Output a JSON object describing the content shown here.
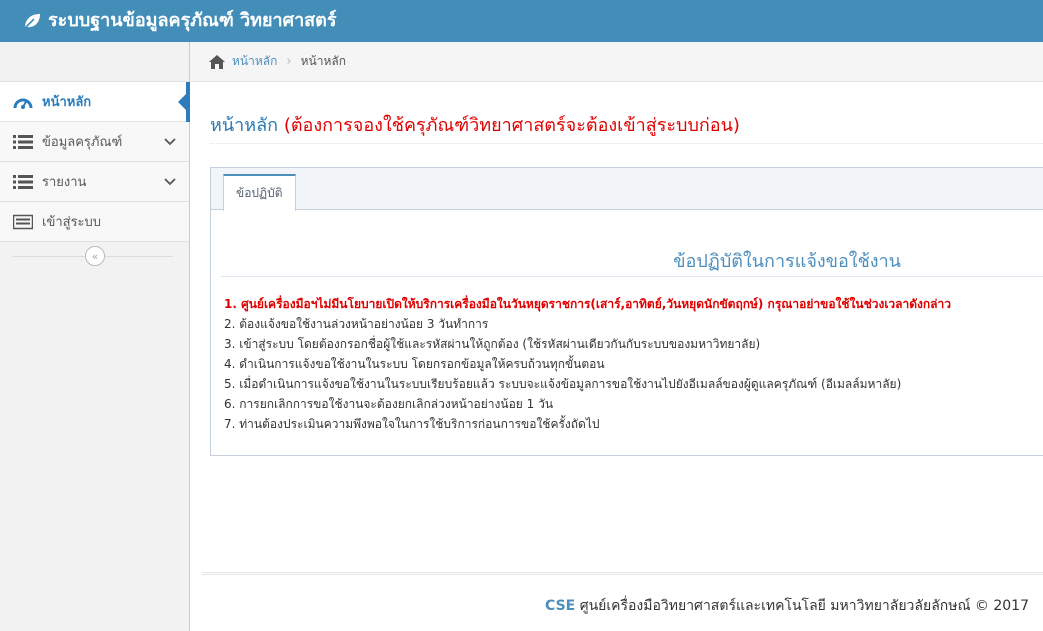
{
  "app": {
    "brand": "ระบบฐานข้อมูลครุภัณฑ์ วิทยาศาสตร์",
    "brand_icon": "leaf-icon"
  },
  "sidebar": {
    "items": [
      {
        "label": "หน้าหลัก",
        "icon": "dashboard-icon",
        "active": true
      },
      {
        "label": "ข้อมูลครุภัณฑ์",
        "icon": "list-icon",
        "expandable": true
      },
      {
        "label": "รายงาน",
        "icon": "list-icon",
        "expandable": true
      },
      {
        "label": "เข้าสู่ระบบ",
        "icon": "keyboard-icon"
      }
    ],
    "collapse_glyph": "«"
  },
  "breadcrumb": {
    "home_icon": "home-icon",
    "link": "หน้าหลัก",
    "separator": "›",
    "current": "หน้าหลัก"
  },
  "page_header": {
    "title": "หน้าหลัก",
    "note": "(ต้องการจองใช้ครุภัณฑ์วิทยาศาสตร์จะต้องเข้าสู่ระบบก่อน)"
  },
  "tabs": [
    {
      "label": "ข้อปฏิบัติ",
      "active": true
    }
  ],
  "panel": {
    "title": "ข้อปฏิบัติในการแจ้งขอใช้งาน",
    "rules": [
      "1. ศูนย์เครื่องมือฯไม่มีนโยบายเปิดให้บริการเครื่องมือในวันหยุดราชการ(เสาร์,อาทิตย์,วันหยุดนักขัตฤกษ์) กรุณาอย่าขอใช้ในช่วงเวลาดังกล่าว",
      "2. ต้องแจ้งขอใช้งานล่วงหน้าอย่างน้อย 3 วันทำการ",
      "3. เข้าสู่ระบบ โดยต้องกรอกชื่อผู้ใช้และรหัสผ่านให้ถูกต้อง (ใช้รหัสผ่านเดียวกันกับระบบของมหาวิทยาลัย)",
      "4. ดำเนินการแจ้งขอใช้งานในระบบ โดยกรอกข้อมูลให้ครบถ้วนทุกขั้นตอน",
      "5. เมื่อดำเนินการแจ้งขอใช้งานในระบบเรียบร้อยแล้ว ระบบจะแจ้งข้อมูลการขอใช้งานไปยังอีเมลล์ของผู้ดูแลครุภัณฑ์ (อีเมลล์มหาลัย)",
      "6. การยกเลิกการขอใช้งานจะต้องยกเลิกล่วงหน้าอย่างน้อย 1 วัน",
      "7. ท่านต้องประเมินความพึงพอใจในการใช้บริการก่อนการขอใช้ครั้งถัดไป"
    ]
  },
  "footer": {
    "org_short": "CSE",
    "text": "ศูนย์เครื่องมือวิทยาศาสตร์และเทคโนโลยี มหาวิทยาลัยวลัยลักษณ์ © 2017"
  },
  "colors": {
    "topbar": "#438eb9",
    "accent": "#2b7dbc",
    "warning": "#e00000"
  }
}
